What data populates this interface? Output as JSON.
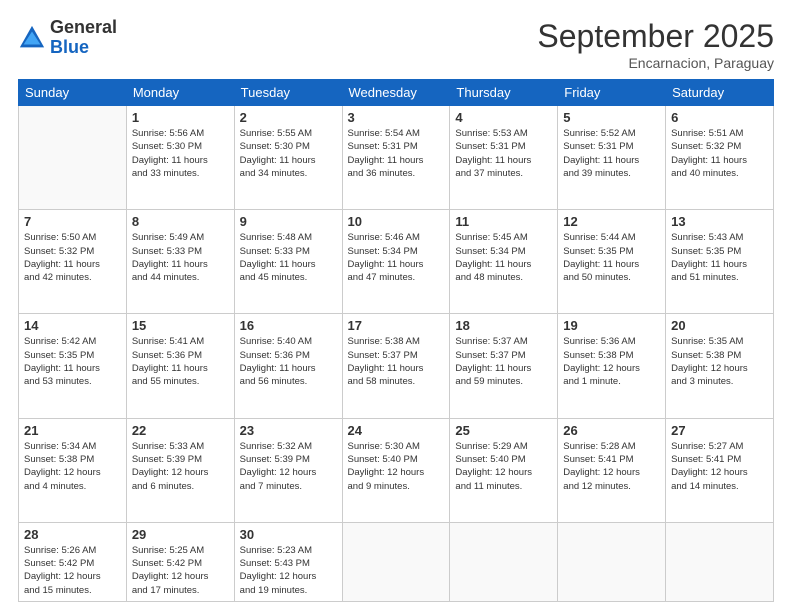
{
  "logo": {
    "general": "General",
    "blue": "Blue"
  },
  "header": {
    "title": "September 2025",
    "subtitle": "Encarnacion, Paraguay"
  },
  "days_of_week": [
    "Sunday",
    "Monday",
    "Tuesday",
    "Wednesday",
    "Thursday",
    "Friday",
    "Saturday"
  ],
  "weeks": [
    [
      {
        "day": "",
        "sunrise": "",
        "sunset": "",
        "daylight": ""
      },
      {
        "day": "1",
        "sunrise": "Sunrise: 5:56 AM",
        "sunset": "Sunset: 5:30 PM",
        "daylight": "Daylight: 11 hours and 33 minutes."
      },
      {
        "day": "2",
        "sunrise": "Sunrise: 5:55 AM",
        "sunset": "Sunset: 5:30 PM",
        "daylight": "Daylight: 11 hours and 34 minutes."
      },
      {
        "day": "3",
        "sunrise": "Sunrise: 5:54 AM",
        "sunset": "Sunset: 5:31 PM",
        "daylight": "Daylight: 11 hours and 36 minutes."
      },
      {
        "day": "4",
        "sunrise": "Sunrise: 5:53 AM",
        "sunset": "Sunset: 5:31 PM",
        "daylight": "Daylight: 11 hours and 37 minutes."
      },
      {
        "day": "5",
        "sunrise": "Sunrise: 5:52 AM",
        "sunset": "Sunset: 5:31 PM",
        "daylight": "Daylight: 11 hours and 39 minutes."
      },
      {
        "day": "6",
        "sunrise": "Sunrise: 5:51 AM",
        "sunset": "Sunset: 5:32 PM",
        "daylight": "Daylight: 11 hours and 40 minutes."
      }
    ],
    [
      {
        "day": "7",
        "sunrise": "Sunrise: 5:50 AM",
        "sunset": "Sunset: 5:32 PM",
        "daylight": "Daylight: 11 hours and 42 minutes."
      },
      {
        "day": "8",
        "sunrise": "Sunrise: 5:49 AM",
        "sunset": "Sunset: 5:33 PM",
        "daylight": "Daylight: 11 hours and 44 minutes."
      },
      {
        "day": "9",
        "sunrise": "Sunrise: 5:48 AM",
        "sunset": "Sunset: 5:33 PM",
        "daylight": "Daylight: 11 hours and 45 minutes."
      },
      {
        "day": "10",
        "sunrise": "Sunrise: 5:46 AM",
        "sunset": "Sunset: 5:34 PM",
        "daylight": "Daylight: 11 hours and 47 minutes."
      },
      {
        "day": "11",
        "sunrise": "Sunrise: 5:45 AM",
        "sunset": "Sunset: 5:34 PM",
        "daylight": "Daylight: 11 hours and 48 minutes."
      },
      {
        "day": "12",
        "sunrise": "Sunrise: 5:44 AM",
        "sunset": "Sunset: 5:35 PM",
        "daylight": "Daylight: 11 hours and 50 minutes."
      },
      {
        "day": "13",
        "sunrise": "Sunrise: 5:43 AM",
        "sunset": "Sunset: 5:35 PM",
        "daylight": "Daylight: 11 hours and 51 minutes."
      }
    ],
    [
      {
        "day": "14",
        "sunrise": "Sunrise: 5:42 AM",
        "sunset": "Sunset: 5:35 PM",
        "daylight": "Daylight: 11 hours and 53 minutes."
      },
      {
        "day": "15",
        "sunrise": "Sunrise: 5:41 AM",
        "sunset": "Sunset: 5:36 PM",
        "daylight": "Daylight: 11 hours and 55 minutes."
      },
      {
        "day": "16",
        "sunrise": "Sunrise: 5:40 AM",
        "sunset": "Sunset: 5:36 PM",
        "daylight": "Daylight: 11 hours and 56 minutes."
      },
      {
        "day": "17",
        "sunrise": "Sunrise: 5:38 AM",
        "sunset": "Sunset: 5:37 PM",
        "daylight": "Daylight: 11 hours and 58 minutes."
      },
      {
        "day": "18",
        "sunrise": "Sunrise: 5:37 AM",
        "sunset": "Sunset: 5:37 PM",
        "daylight": "Daylight: 11 hours and 59 minutes."
      },
      {
        "day": "19",
        "sunrise": "Sunrise: 5:36 AM",
        "sunset": "Sunset: 5:38 PM",
        "daylight": "Daylight: 12 hours and 1 minute."
      },
      {
        "day": "20",
        "sunrise": "Sunrise: 5:35 AM",
        "sunset": "Sunset: 5:38 PM",
        "daylight": "Daylight: 12 hours and 3 minutes."
      }
    ],
    [
      {
        "day": "21",
        "sunrise": "Sunrise: 5:34 AM",
        "sunset": "Sunset: 5:38 PM",
        "daylight": "Daylight: 12 hours and 4 minutes."
      },
      {
        "day": "22",
        "sunrise": "Sunrise: 5:33 AM",
        "sunset": "Sunset: 5:39 PM",
        "daylight": "Daylight: 12 hours and 6 minutes."
      },
      {
        "day": "23",
        "sunrise": "Sunrise: 5:32 AM",
        "sunset": "Sunset: 5:39 PM",
        "daylight": "Daylight: 12 hours and 7 minutes."
      },
      {
        "day": "24",
        "sunrise": "Sunrise: 5:30 AM",
        "sunset": "Sunset: 5:40 PM",
        "daylight": "Daylight: 12 hours and 9 minutes."
      },
      {
        "day": "25",
        "sunrise": "Sunrise: 5:29 AM",
        "sunset": "Sunset: 5:40 PM",
        "daylight": "Daylight: 12 hours and 11 minutes."
      },
      {
        "day": "26",
        "sunrise": "Sunrise: 5:28 AM",
        "sunset": "Sunset: 5:41 PM",
        "daylight": "Daylight: 12 hours and 12 minutes."
      },
      {
        "day": "27",
        "sunrise": "Sunrise: 5:27 AM",
        "sunset": "Sunset: 5:41 PM",
        "daylight": "Daylight: 12 hours and 14 minutes."
      }
    ],
    [
      {
        "day": "28",
        "sunrise": "Sunrise: 5:26 AM",
        "sunset": "Sunset: 5:42 PM",
        "daylight": "Daylight: 12 hours and 15 minutes."
      },
      {
        "day": "29",
        "sunrise": "Sunrise: 5:25 AM",
        "sunset": "Sunset: 5:42 PM",
        "daylight": "Daylight: 12 hours and 17 minutes."
      },
      {
        "day": "30",
        "sunrise": "Sunrise: 5:23 AM",
        "sunset": "Sunset: 5:43 PM",
        "daylight": "Daylight: 12 hours and 19 minutes."
      },
      {
        "day": "",
        "sunrise": "",
        "sunset": "",
        "daylight": ""
      },
      {
        "day": "",
        "sunrise": "",
        "sunset": "",
        "daylight": ""
      },
      {
        "day": "",
        "sunrise": "",
        "sunset": "",
        "daylight": ""
      },
      {
        "day": "",
        "sunrise": "",
        "sunset": "",
        "daylight": ""
      }
    ]
  ]
}
